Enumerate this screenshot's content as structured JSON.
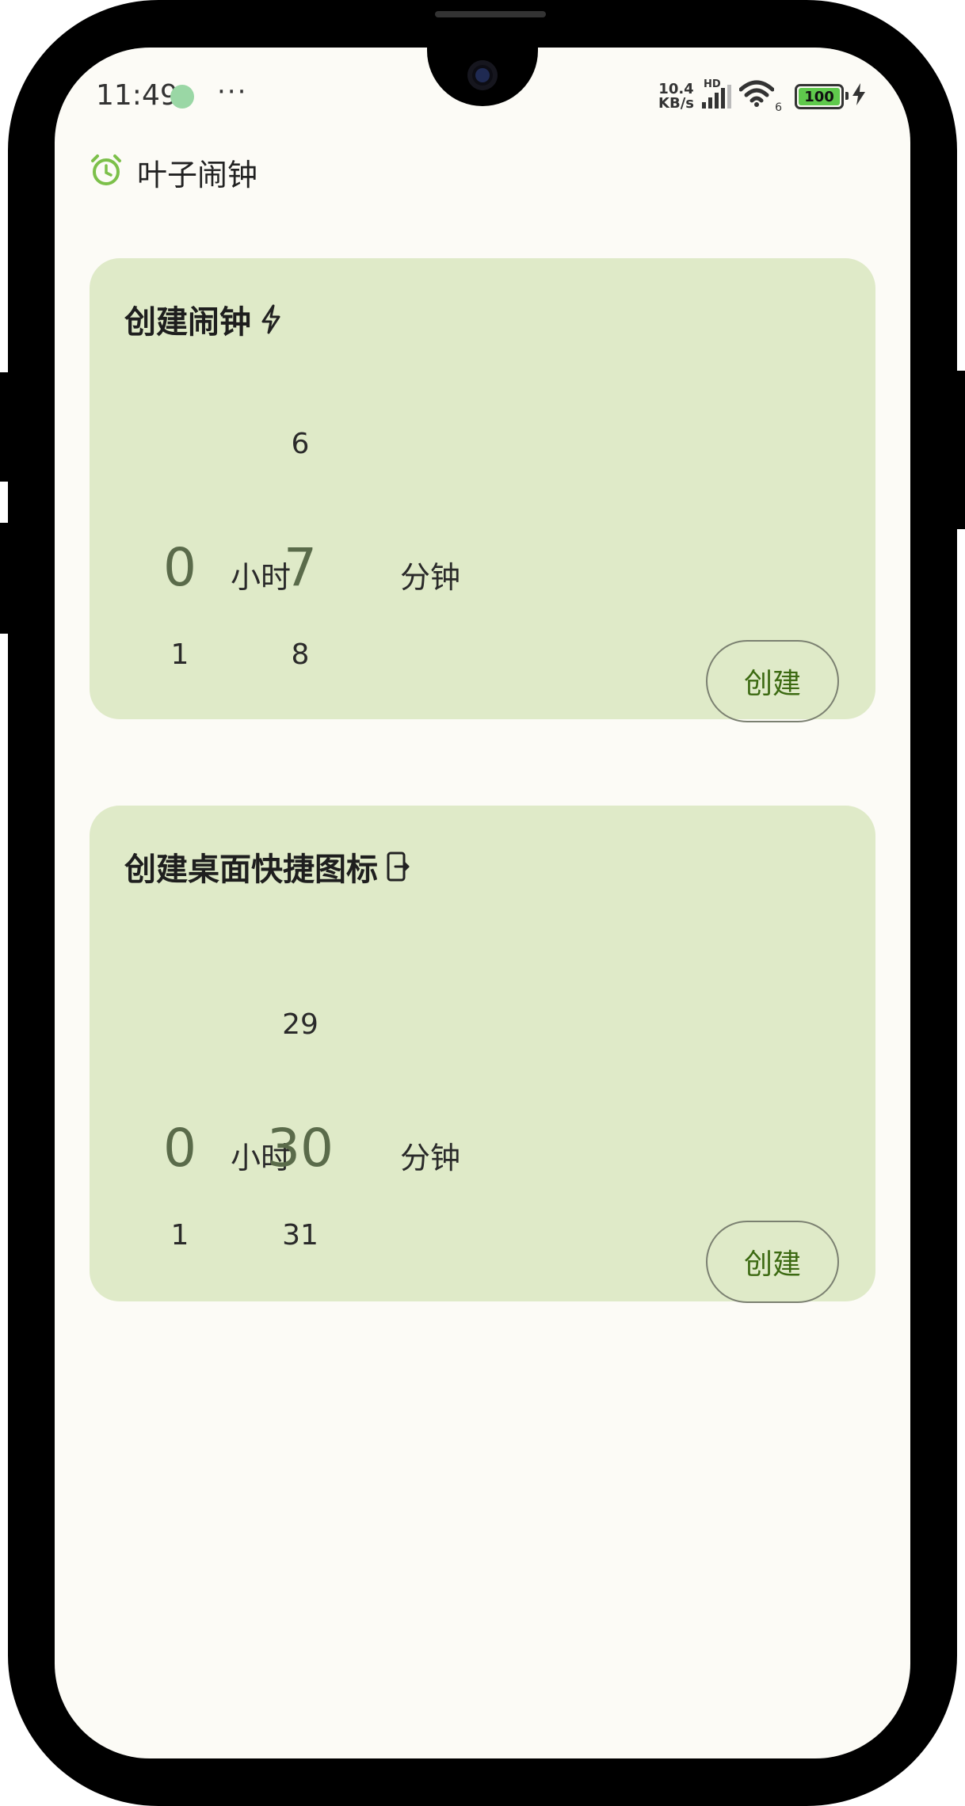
{
  "status_bar": {
    "time": "11:49",
    "more": "···",
    "net_speed_value": "10.4",
    "net_speed_unit": "KB/s",
    "signal_label": "HD",
    "wifi_badge": "6",
    "battery_level": "100",
    "battery_color": "#5fc94c"
  },
  "app_bar": {
    "icon": "alarm-clock-icon",
    "title": "叶子闹钟"
  },
  "alarm_card": {
    "title": "创建闹钟",
    "title_icon": "bolt-icon",
    "hours": {
      "prev": "",
      "current": "0",
      "next": "1"
    },
    "hours_unit": "小时",
    "minutes": {
      "prev": "6",
      "current": "7",
      "next": "8"
    },
    "minutes_unit": "分钟",
    "create_label": "创建"
  },
  "shortcut_card": {
    "title": "创建桌面快捷图标",
    "title_icon": "phone-shortcut-icon",
    "hours": {
      "prev": "",
      "current": "0",
      "next": "1"
    },
    "hours_unit": "小时",
    "minutes": {
      "prev": "29",
      "current": "30",
      "next": "31"
    },
    "minutes_unit": "分钟",
    "create_label": "创建"
  },
  "colors": {
    "card_bg": "#dfeac8",
    "accent": "#3c6a12",
    "screen_bg": "#fcfbf6"
  }
}
